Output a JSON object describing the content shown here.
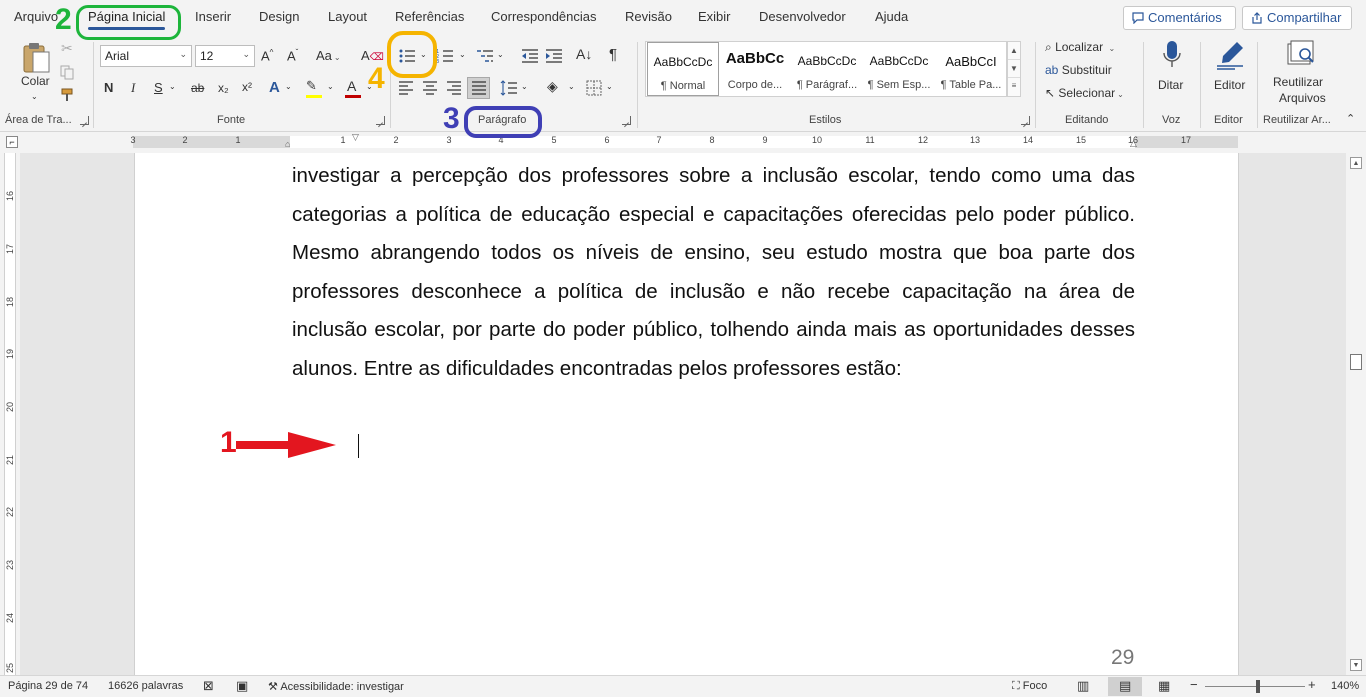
{
  "tabs": [
    {
      "label": "Arquivo",
      "active": false
    },
    {
      "label": "Página Inicial",
      "active": true
    },
    {
      "label": "Inserir",
      "active": false
    },
    {
      "label": "Design",
      "active": false
    },
    {
      "label": "Layout",
      "active": false
    },
    {
      "label": "Referências",
      "active": false
    },
    {
      "label": "Correspondências",
      "active": false
    },
    {
      "label": "Revisão",
      "active": false
    },
    {
      "label": "Exibir",
      "active": false
    },
    {
      "label": "Desenvolvedor",
      "active": false
    },
    {
      "label": "Ajuda",
      "active": false
    }
  ],
  "top_buttons": {
    "comments": "Comentários",
    "share": "Compartilhar"
  },
  "clipboard": {
    "paste": "Colar",
    "label": "Área de Tra..."
  },
  "font": {
    "name": "Arial",
    "size": "12",
    "label": "Fonte",
    "bold": "N",
    "italic": "I",
    "underline": "S",
    "strike": "ab",
    "sub": "x₂",
    "sup": "x²",
    "case": "Aa"
  },
  "paragraph": {
    "label": "Parágrafo"
  },
  "styles": {
    "label": "Estilos",
    "items": [
      {
        "sample": "AaBbCcDc",
        "name": "¶ Normal"
      },
      {
        "sample": "AaBbCc",
        "name": "Corpo de..."
      },
      {
        "sample": "AaBbCcDc",
        "name": "¶ Parágraf..."
      },
      {
        "sample": "AaBbCcDc",
        "name": "¶ Sem Esp..."
      },
      {
        "sample": "AaBbCcI",
        "name": "¶ Table Pa..."
      }
    ]
  },
  "editing": {
    "label": "Editando",
    "find": "Localizar",
    "replace": "Substituir",
    "select": "Selecionar"
  },
  "voice": {
    "dictate": "Ditar",
    "label": "Voz"
  },
  "editor": {
    "button": "Editor",
    "label": "Editor"
  },
  "reuse": {
    "button_line1": "Reutilizar",
    "button_line2": "Arquivos",
    "label": "Reutilizar Ar..."
  },
  "ruler": {
    "numbers": [
      "3",
      "2",
      "1",
      "1",
      "2",
      "3",
      "4",
      "5",
      "6",
      "7",
      "8",
      "9",
      "10",
      "11",
      "12",
      "13",
      "14",
      "15",
      "16",
      "17"
    ]
  },
  "vruler": {
    "numbers": [
      "16",
      "17",
      "18",
      "19",
      "20",
      "21",
      "22",
      "23",
      "24",
      "25"
    ]
  },
  "document": {
    "paragraph": "investigar a percepção dos professores sobre a inclusão escolar, tendo como uma das categorias a política de educação especial e capacitações oferecidas pelo poder público. Mesmo abrangendo todos os níveis de ensino, seu estudo mostra que boa parte dos professores desconhece a política de inclusão e não recebe capacitação na área de inclusão escolar, por parte do poder público, tolhendo ainda mais as oportunidades desses alunos. Entre as dificuldades encontradas pelos professores estão:",
    "page_number": "29"
  },
  "annotations": {
    "n1": "1",
    "n2": "2",
    "n3": "3",
    "n4": "4",
    "colors": {
      "red": "#e3161f",
      "green": "#1db53b",
      "blue": "#3f3fb5",
      "yellow": "#f5b400"
    }
  },
  "status": {
    "page": "Página 29 de 74",
    "words": "16626 palavras",
    "accessibility": "Acessibilidade: investigar",
    "focus": "Foco",
    "zoom": "140%"
  },
  "colors": {
    "accent": "#2b579a",
    "font_color_bar": "#c00000",
    "highlight_bar": "#ffff00"
  }
}
